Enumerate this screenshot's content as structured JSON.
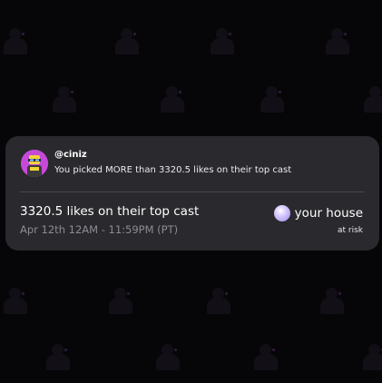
{
  "notification": {
    "handle": "@ciniz",
    "pick_text": "You picked MORE than 3320.5 likes on their top cast",
    "market_title": "3320.5 likes on their top cast",
    "market_time": "Apr 12th 12AM - 11:59PM (PT)",
    "stake_label": "your house",
    "stake_status": "at risk"
  },
  "colors": {
    "background": "#060608",
    "card": "#2a292d",
    "avatar": "#c64ad9",
    "muted_text": "#8e8b94"
  },
  "icons": {
    "avatar": "user-avatar-icon",
    "stake": "house-orb-icon",
    "background": "silhouette-pattern"
  }
}
